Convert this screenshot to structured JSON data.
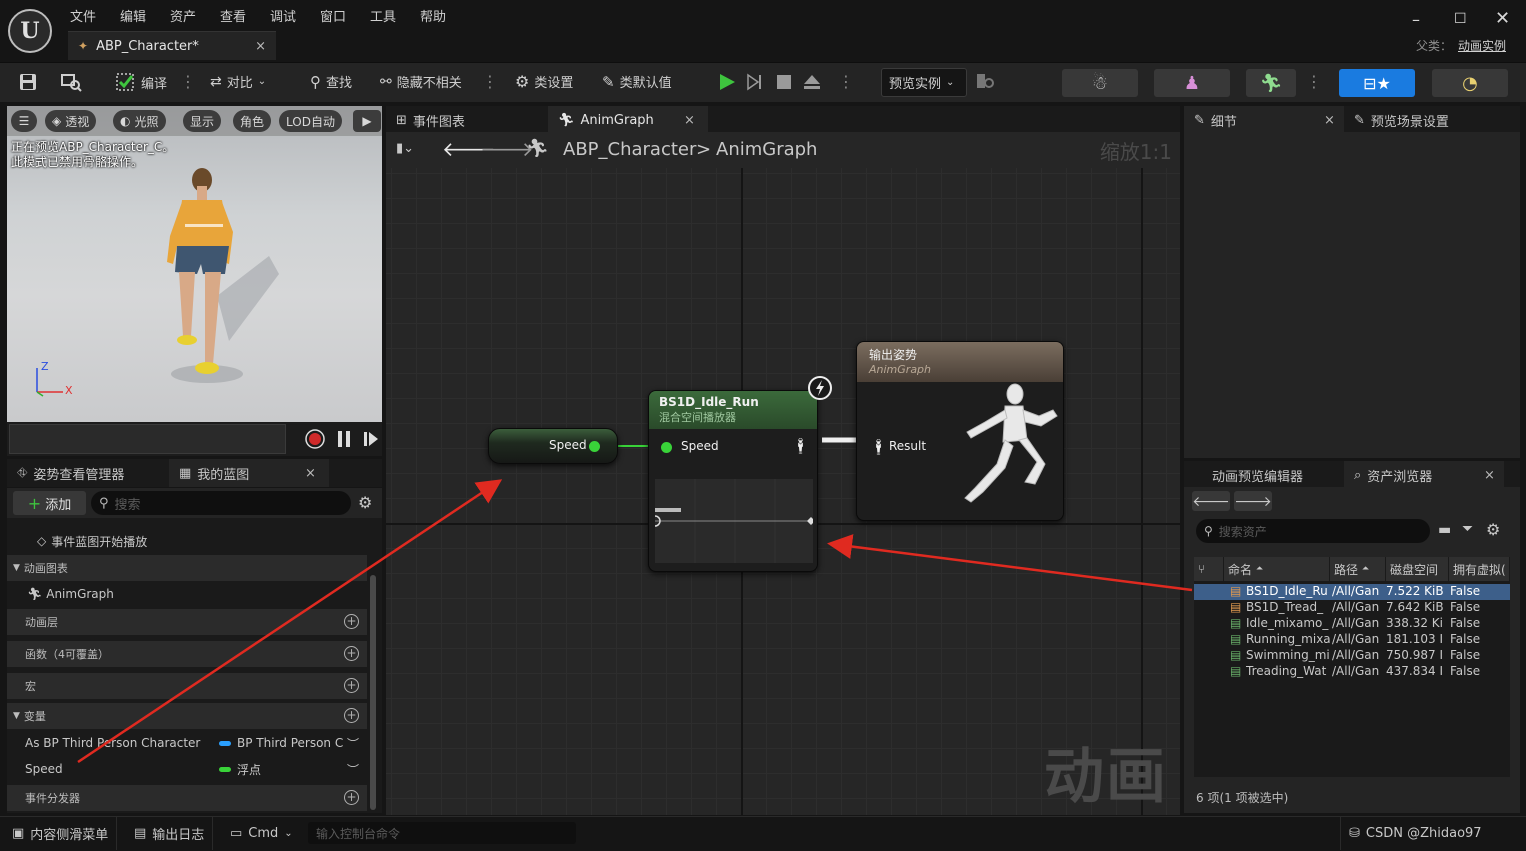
{
  "window": {
    "menu": [
      "文件",
      "编辑",
      "资产",
      "查看",
      "调试",
      "窗口",
      "工具",
      "帮助"
    ],
    "doc_tab": "ABP_Character*",
    "parent_label": "父类：",
    "parent_value": "动画实例"
  },
  "toolbar": {
    "compile": "编译",
    "diff": "对比",
    "find": "查找",
    "hide_unrelated": "隐藏不相关",
    "class_settings": "类设置",
    "class_defaults": "类默认值",
    "preview_instance": "预览实例"
  },
  "viewport": {
    "perspective": "透视",
    "lighting": "光照",
    "show": "显示",
    "character": "角色",
    "lod": "LOD自动",
    "message_line1": "正在预览ABP_Character_C。",
    "message_line2": "此模式已禁用骨骼操作。",
    "axis_z": "Z",
    "axis_x": "X"
  },
  "left_panel": {
    "tab_pose": "姿势查看管理器",
    "tab_mybp": "我的蓝图",
    "add": "添加",
    "search_placeholder": "搜索",
    "event_begin": "事件蓝图开始播放",
    "cat_animgraphs": "动画图表",
    "animgraph": "AnimGraph",
    "cat_layers": "动画层",
    "cat_functions": "函数（4可覆盖）",
    "cat_macros": "宏",
    "cat_variables": "变量",
    "var1_name": "As BP Third Person Character",
    "var1_type": "BP Third Person C",
    "var2_name": "Speed",
    "var2_type": "浮点",
    "cat_dispatchers": "事件分发器"
  },
  "graph": {
    "tab_event": "事件图表",
    "tab_anim": "AnimGraph",
    "crumb_root": "ABP_Character",
    "crumb_sep": ">",
    "crumb_leaf": "AnimGraph",
    "zoom": "缩放1:1",
    "watermark": "动画",
    "node_speed": "Speed",
    "bs_title": "BS1D_Idle_Run",
    "bs_subtitle": "混合空间播放器",
    "bs_pin": "Speed",
    "out_title": "输出姿势",
    "out_subtitle": "AnimGraph",
    "out_pin": "Result"
  },
  "details": {
    "tab_details": "细节",
    "tab_preview": "预览场景设置"
  },
  "asset_browser": {
    "tab_preview_editor": "动画预览编辑器",
    "tab_browser": "资产浏览器",
    "search_placeholder": "搜索资产",
    "col_name": "命名",
    "col_path": "路径",
    "col_size": "磁盘空间",
    "col_virtual": "拥有虚拟(",
    "rows": [
      {
        "name": "BS1D_Idle_Ru",
        "path": "/All/Gan",
        "size": "7.522 KiB",
        "virtual": "False"
      },
      {
        "name": "BS1D_Tread_",
        "path": "/All/Gan",
        "size": "7.642 KiB",
        "virtual": "False"
      },
      {
        "name": "Idle_mixamo_",
        "path": "/All/Gan",
        "size": "338.32 Ki",
        "virtual": "False"
      },
      {
        "name": "Running_mixa",
        "path": "/All/Gan",
        "size": "181.103 I",
        "virtual": "False"
      },
      {
        "name": "Swimming_mi",
        "path": "/All/Gan",
        "size": "750.987 I",
        "virtual": "False"
      },
      {
        "name": "Treading_Wat",
        "path": "/All/Gan",
        "size": "437.834 I",
        "virtual": "False"
      }
    ],
    "status": "6 项(1 项被选中)"
  },
  "statusbar": {
    "content_drawer": "内容侧滑菜单",
    "output_log": "输出日志",
    "cmd": "Cmd",
    "console_placeholder": "输入控制台命令",
    "source_control": "CSDN @Zhidao97"
  },
  "colors": {
    "selection": "#3d5f8a",
    "play_green": "#3ec43e",
    "float_pin": "#39d339",
    "object_pin": "#2aa0ff",
    "annotation_red": "#e02a20"
  }
}
